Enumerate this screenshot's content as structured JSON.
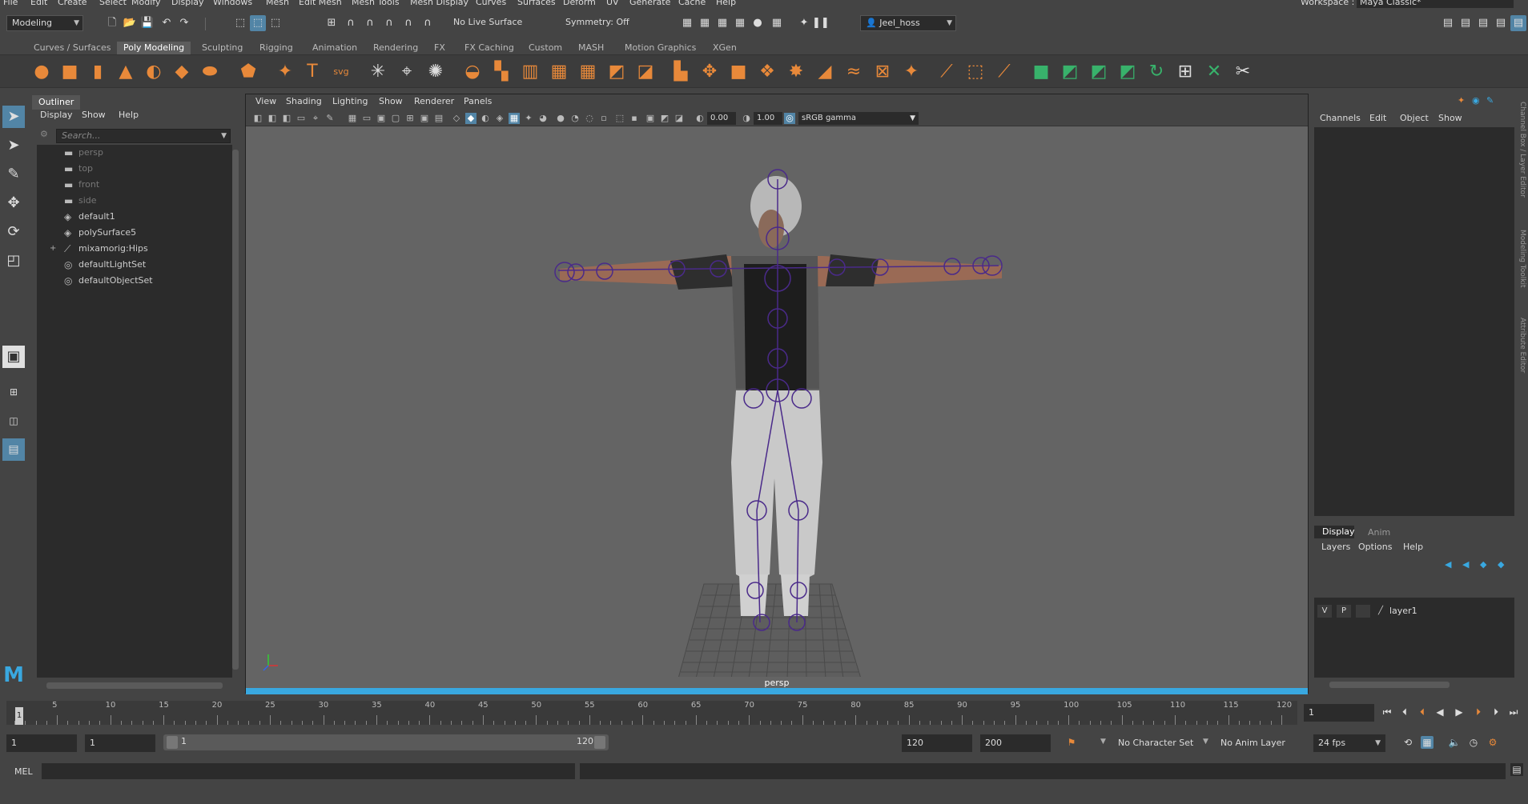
{
  "menubar": {
    "items": [
      "File",
      "Edit",
      "Create",
      "Select",
      "Modify",
      "Display",
      "Windows",
      "Mesh",
      "Edit Mesh",
      "Mesh Tools",
      "Mesh Display",
      "Curves",
      "Surfaces",
      "Deform",
      "UV",
      "Generate",
      "Cache",
      "Help"
    ],
    "workspace_label": "Workspace :",
    "workspace_value": "Maya Classic*"
  },
  "statusline": {
    "menu_set": "Modeling",
    "live_surface": "No Live Surface",
    "symmetry": "Symmetry: Off",
    "user": "Jeel_hoss"
  },
  "shelf_tabs": [
    "Curves / Surfaces",
    "Poly Modeling",
    "Sculpting",
    "Rigging",
    "Animation",
    "Rendering",
    "FX",
    "FX Caching",
    "Custom",
    "MASH",
    "Motion Graphics",
    "XGen"
  ],
  "shelf_active": "Poly Modeling",
  "outliner": {
    "title": "Outliner",
    "menus": [
      "Display",
      "Show",
      "Help"
    ],
    "search_placeholder": "Search...",
    "items": [
      {
        "label": "persp",
        "icon": "camera-icon",
        "dim": true
      },
      {
        "label": "top",
        "icon": "camera-icon",
        "dim": true
      },
      {
        "label": "front",
        "icon": "camera-icon",
        "dim": true
      },
      {
        "label": "side",
        "icon": "camera-icon",
        "dim": true
      },
      {
        "label": "default1",
        "icon": "mesh-icon",
        "dim": false
      },
      {
        "label": "polySurface5",
        "icon": "mesh-icon",
        "dim": false
      },
      {
        "label": "mixamorig:Hips",
        "icon": "joint-icon",
        "dim": false,
        "expand": "+"
      },
      {
        "label": "defaultLightSet",
        "icon": "set-icon",
        "dim": false
      },
      {
        "label": "defaultObjectSet",
        "icon": "set-icon",
        "dim": false
      }
    ]
  },
  "viewport": {
    "menus": [
      "View",
      "Shading",
      "Lighting",
      "Show",
      "Renderer",
      "Panels"
    ],
    "exposure": "0.00",
    "gamma": "1.00",
    "color_space": "sRGB gamma",
    "camera_label": "persp"
  },
  "channelbox": {
    "menus": [
      "Channels",
      "Edit",
      "Object",
      "Show"
    ]
  },
  "layereditor": {
    "tabs": [
      "Display",
      "Anim"
    ],
    "menus": [
      "Layers",
      "Options",
      "Help"
    ],
    "layer": {
      "v": "V",
      "p": "P",
      "name": "layer1"
    }
  },
  "sidetabs": [
    "Channel Box / Layer Editor",
    "Modeling Toolkit",
    "Attribute Editor"
  ],
  "timeslider": {
    "ticks": [
      5,
      10,
      15,
      20,
      25,
      30,
      35,
      40,
      45,
      50,
      55,
      60,
      65,
      70,
      75,
      80,
      85,
      90,
      95,
      100,
      105,
      110,
      115,
      120
    ],
    "current_frame": "1",
    "current_field": "1"
  },
  "rangebar": {
    "start": "1",
    "playback_start": "1",
    "slider_start": "1",
    "slider_end": "120",
    "playback_end": "120",
    "end": "200",
    "character_set": "No Character Set",
    "anim_layer": "No Anim Layer",
    "fps": "24 fps"
  },
  "cmdline": {
    "label": "MEL"
  }
}
